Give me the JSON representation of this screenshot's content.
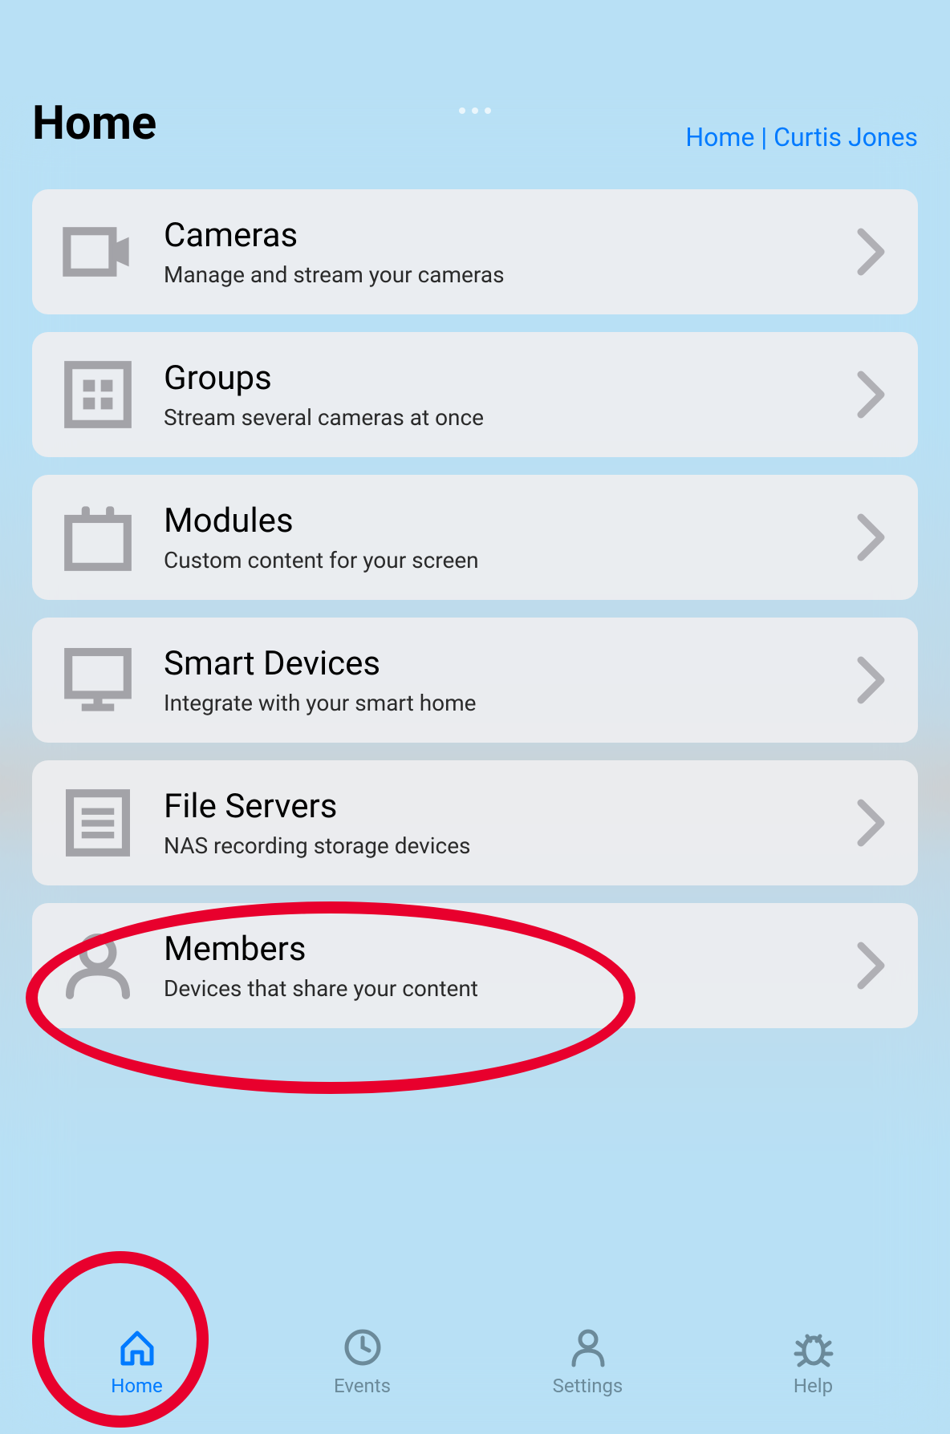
{
  "breadcrumb": "Home | Curtis Jones",
  "page_title": "Home",
  "menu": [
    {
      "title": "Cameras",
      "subtitle": "Manage and stream your cameras",
      "icon_name": "camera-icon"
    },
    {
      "title": "Groups",
      "subtitle": "Stream several cameras at once",
      "icon_name": "groups-icon"
    },
    {
      "title": "Modules",
      "subtitle": "Custom content for your screen",
      "icon_name": "modules-icon"
    },
    {
      "title": "Smart Devices",
      "subtitle": "Integrate with your smart home",
      "icon_name": "monitor-icon"
    },
    {
      "title": "File Servers",
      "subtitle": "NAS recording storage devices",
      "icon_name": "file-list-icon"
    },
    {
      "title": "Members",
      "subtitle": "Devices that share your content",
      "icon_name": "person-icon"
    }
  ],
  "tabs": {
    "home": "Home",
    "events": "Events",
    "settings": "Settings",
    "help": "Help"
  },
  "colors": {
    "accent": "#007aff",
    "inactive": "#6b8a9a",
    "icon_gray": "#a3a3a8",
    "annotation": "#e8002d"
  }
}
